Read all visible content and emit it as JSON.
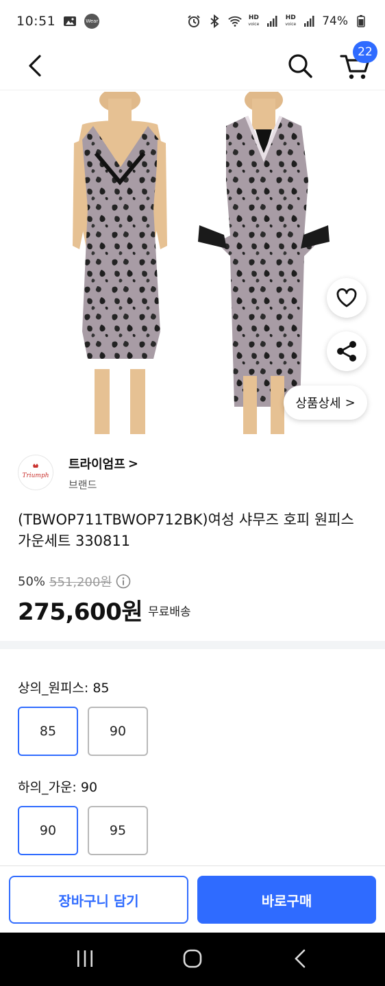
{
  "status_bar": {
    "time": "10:51",
    "wear_badge": "Wear",
    "hd_top": "HD",
    "hd_bottom": "voice",
    "battery": "74%"
  },
  "header": {
    "cart_count": "22"
  },
  "image_overlay": {
    "detail_label": "상품상세",
    "detail_chevron": ">"
  },
  "brand": {
    "logo_text": "Triumph",
    "name": "트라이엄프",
    "chevron": ">",
    "type": "브랜드"
  },
  "product": {
    "title": "(TBWOP711TBWOP712BK)여성 샤무즈 호피 원피스가운세트 330811",
    "discount": "50%",
    "original_price": "551,200원",
    "sale_price": "275,600원",
    "shipping": "무료배송"
  },
  "options": {
    "top": {
      "label": "상의_원피스: 85",
      "values": [
        "85",
        "90"
      ],
      "selected": "85"
    },
    "bottom": {
      "label": "하의_가운: 90",
      "values": [
        "90",
        "95"
      ],
      "selected": "90"
    }
  },
  "actions": {
    "add_to_cart": "장바구니 담기",
    "buy_now": "바로구매"
  },
  "colors": {
    "accent": "#2f6bff"
  }
}
